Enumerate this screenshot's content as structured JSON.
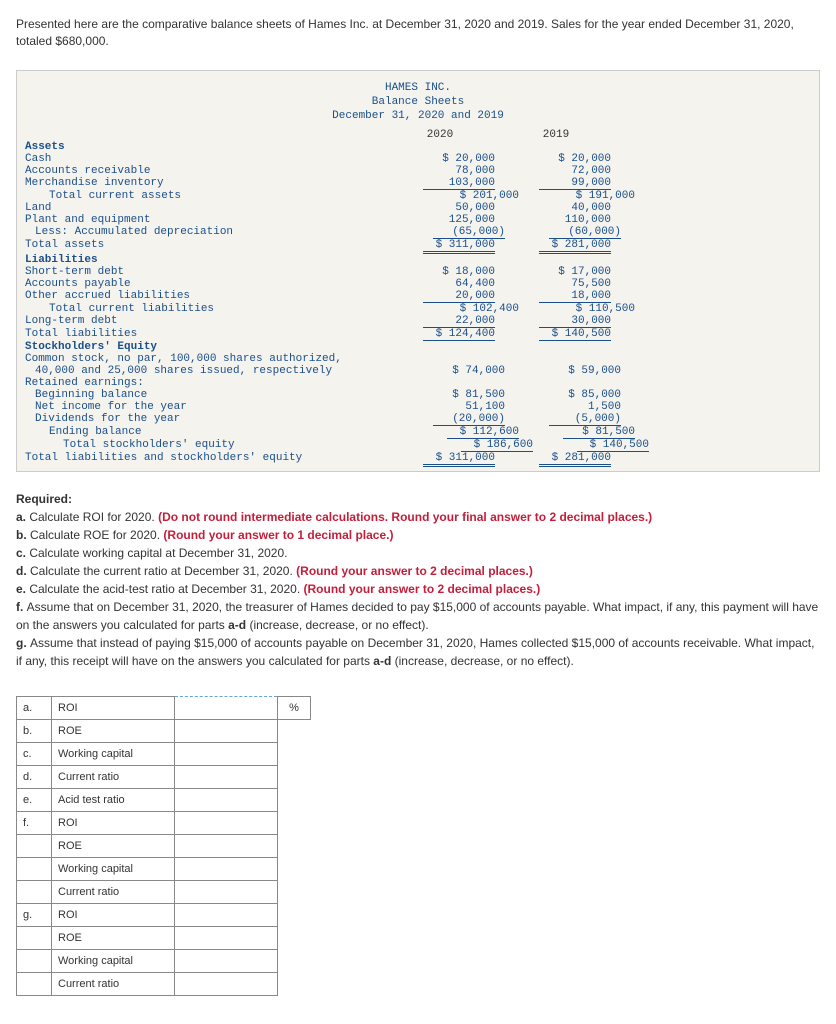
{
  "intro": "Presented here are the comparative balance sheets of Hames Inc. at December 31, 2020 and 2019. Sales for the year ended December 31, 2020, totaled $680,000.",
  "sheet": {
    "h1": "HAMES INC.",
    "h2": "Balance Sheets",
    "h3": "December 31, 2020 and 2019",
    "colA": "2020",
    "colB": "2019",
    "rows": {
      "assets": "Assets",
      "cash": {
        "l": "Cash",
        "a": "$  20,000",
        "b": "$  20,000"
      },
      "ar": {
        "l": "Accounts receivable",
        "a": "78,000",
        "b": "72,000"
      },
      "inv": {
        "l": "Merchandise inventory",
        "a": "103,000",
        "b": "99,000"
      },
      "tca": {
        "l": "Total current assets",
        "a": "$ 201,000",
        "b": "$ 191,000"
      },
      "land": {
        "l": "Land",
        "a": "50,000",
        "b": "40,000"
      },
      "pe": {
        "l": "Plant and equipment",
        "a": "125,000",
        "b": "110,000"
      },
      "dep": {
        "l": "Less: Accumulated depreciation",
        "a": "(65,000)",
        "b": "(60,000)"
      },
      "ta": {
        "l": "Total assets",
        "a": "$ 311,000",
        "b": "$ 281,000"
      },
      "liab": "Liabilities",
      "std": {
        "l": "Short-term debt",
        "a": "$  18,000",
        "b": "$  17,000"
      },
      "ap": {
        "l": "Accounts payable",
        "a": "64,400",
        "b": "75,500"
      },
      "oal": {
        "l": "Other accrued liabilities",
        "a": "20,000",
        "b": "18,000"
      },
      "tcl": {
        "l": "Total current liabilities",
        "a": "$ 102,400",
        "b": "$ 110,500"
      },
      "ltd": {
        "l": "Long-term debt",
        "a": "22,000",
        "b": "30,000"
      },
      "tl": {
        "l": "Total liabilities",
        "a": "$ 124,400",
        "b": "$ 140,500"
      },
      "se": "Stockholders' Equity",
      "cs1": "Common stock, no par, 100,000 shares authorized,",
      "cs2": {
        "l": "40,000 and 25,000 shares issued, respectively",
        "a": "$  74,000",
        "b": "$  59,000"
      },
      "re": "Retained earnings:",
      "bb": {
        "l": "Beginning balance",
        "a": "$  81,500",
        "b": "$  85,000"
      },
      "ni": {
        "l": "Net income for the year",
        "a": "51,100",
        "b": "1,500"
      },
      "div": {
        "l": "Dividends for the year",
        "a": "(20,000)",
        "b": "(5,000)"
      },
      "eb": {
        "l": "Ending balance",
        "a": "$ 112,600",
        "b": "$  81,500"
      },
      "tse": {
        "l": "Total stockholders' equity",
        "a": "$ 186,600",
        "b": "$ 140,500"
      },
      "tlse": {
        "l": "Total liabilities and stockholders' equity",
        "a": "$ 311,000",
        "b": "$ 281,000"
      }
    }
  },
  "required": {
    "title": "Required:",
    "a": {
      "pre": "a. ",
      "txt": "Calculate ROI for 2020. ",
      "red": "(Do not round intermediate calculations. Round your final answer to 2 decimal places.)"
    },
    "b": {
      "pre": "b. ",
      "txt": "Calculate ROE for 2020. ",
      "red": "(Round your answer to 1 decimal place.)"
    },
    "c": {
      "pre": "c. ",
      "txt": "Calculate working capital at December 31, 2020."
    },
    "d": {
      "pre": "d. ",
      "txt": "Calculate the current ratio at December 31, 2020. ",
      "red": "(Round your answer to 2 decimal places.)"
    },
    "e": {
      "pre": "e. ",
      "txt": "Calculate the acid-test ratio at December 31, 2020. ",
      "red": "(Round your answer to 2 decimal places.)"
    },
    "f": {
      "pre": "f. ",
      "txt": "Assume that on December 31, 2020, the treasurer of Hames decided to pay $15,000 of accounts payable. What impact, if any, this payment will have on the answers you calculated for parts ",
      "b2": "a-d",
      "txt2": " (increase, decrease, or no effect)."
    },
    "g": {
      "pre": "g. ",
      "txt": "Assume that instead of paying $15,000 of accounts payable on December 31, 2020, Hames collected $15,000 of accounts receivable. What impact, if any, this receipt will have on the answers you calculated for parts ",
      "b2": "a-d",
      "txt2": " (increase, decrease, or no effect)."
    }
  },
  "answers": {
    "rows": [
      {
        "idx": "a.",
        "lab": "ROI",
        "unit": "%"
      },
      {
        "idx": "b.",
        "lab": "ROE"
      },
      {
        "idx": "c.",
        "lab": "Working capital"
      },
      {
        "idx": "d.",
        "lab": "Current ratio"
      },
      {
        "idx": "e.",
        "lab": "Acid test ratio"
      },
      {
        "idx": "f.",
        "lab": "ROI"
      },
      {
        "idx": "",
        "lab": "ROE"
      },
      {
        "idx": "",
        "lab": "Working capital"
      },
      {
        "idx": "",
        "lab": "Current ratio"
      },
      {
        "idx": "g.",
        "lab": "ROI"
      },
      {
        "idx": "",
        "lab": "ROE"
      },
      {
        "idx": "",
        "lab": "Working capital"
      },
      {
        "idx": "",
        "lab": "Current ratio"
      }
    ]
  }
}
